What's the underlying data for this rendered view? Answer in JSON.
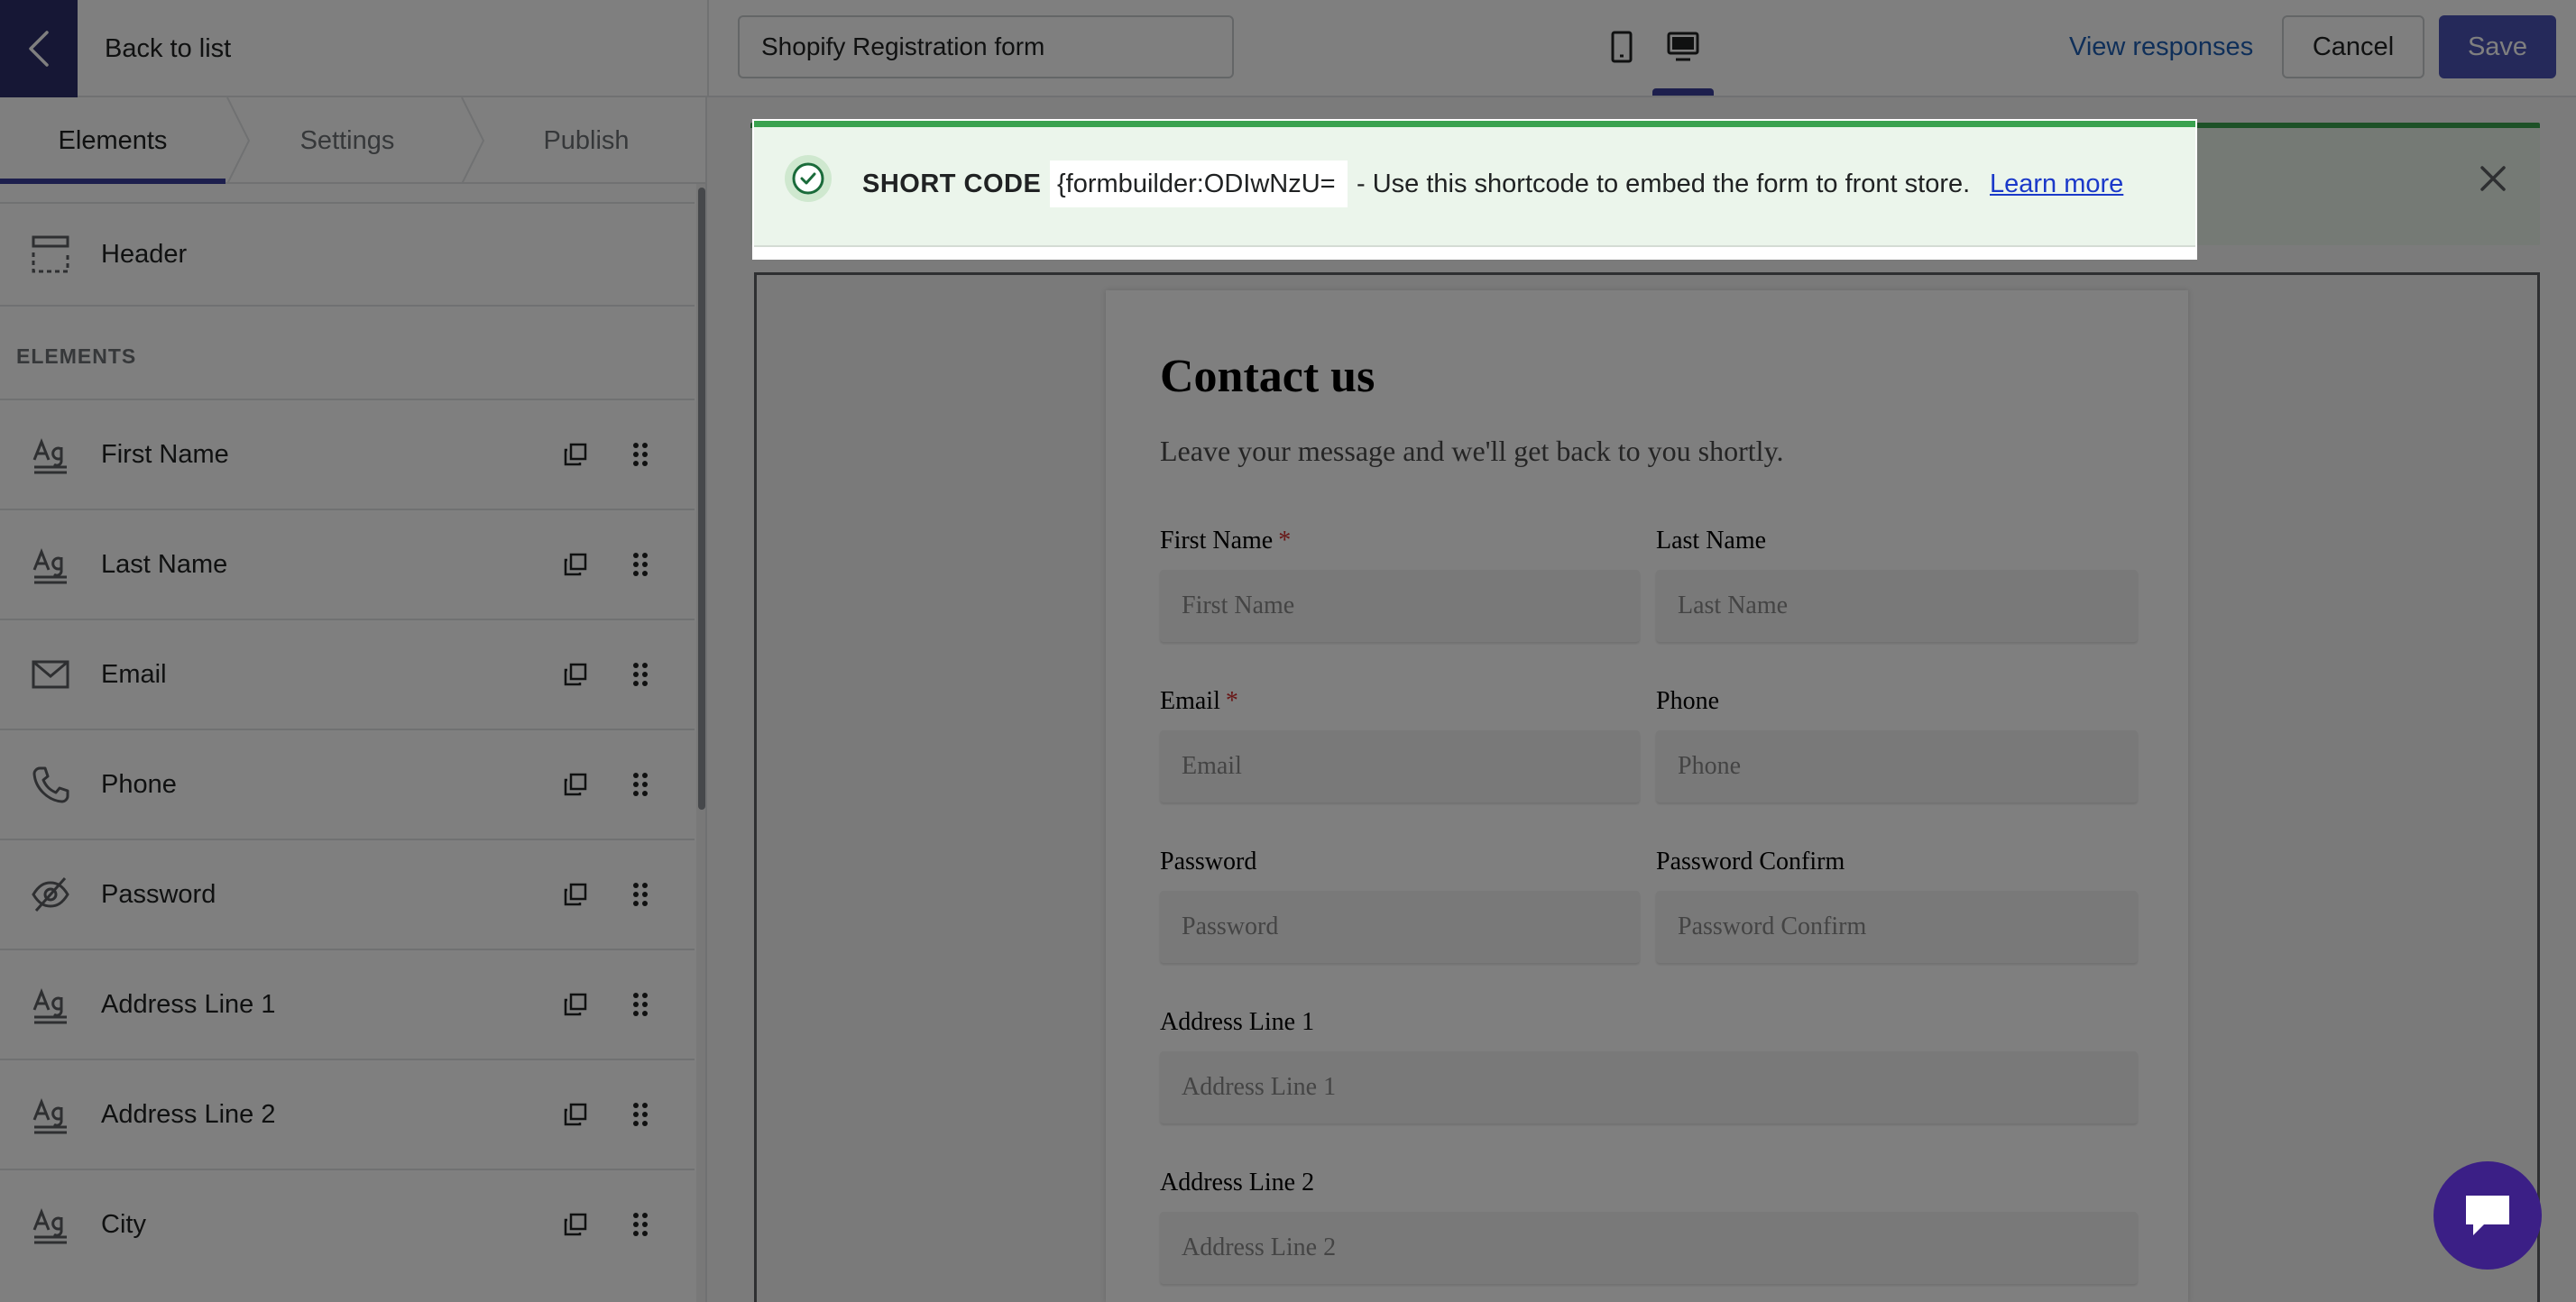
{
  "topbar": {
    "back_label": "Back to list",
    "form_title": "Shopify Registration form",
    "view_responses": "View responses",
    "cancel": "Cancel",
    "save": "Save"
  },
  "sidebar": {
    "tabs": [
      "Elements",
      "Settings",
      "Publish"
    ],
    "header_item": "Header",
    "section_title": "ELEMENTS",
    "items": [
      {
        "label": "First Name",
        "icon": "text-icon"
      },
      {
        "label": "Last Name",
        "icon": "text-icon"
      },
      {
        "label": "Email",
        "icon": "mail-icon"
      },
      {
        "label": "Phone",
        "icon": "phone-icon"
      },
      {
        "label": "Password",
        "icon": "eye-off-icon"
      },
      {
        "label": "Address Line 1",
        "icon": "text-icon"
      },
      {
        "label": "Address Line 2",
        "icon": "text-icon"
      },
      {
        "label": "City",
        "icon": "text-icon"
      }
    ]
  },
  "banner": {
    "label": "SHORT CODE :",
    "code": "{formbuilder:ODIwNzU=",
    "description": "- Use this shortcode to embed the form to front store.",
    "link": "Learn more"
  },
  "form": {
    "heading": "Contact us",
    "description": "Leave your message and we'll get back to you shortly.",
    "fields": {
      "first_name": {
        "label": "First Name",
        "placeholder": "First Name",
        "required": "*"
      },
      "last_name": {
        "label": "Last Name",
        "placeholder": "Last Name"
      },
      "email": {
        "label": "Email",
        "placeholder": "Email",
        "required": "*"
      },
      "phone": {
        "label": "Phone",
        "placeholder": "Phone"
      },
      "password": {
        "label": "Password",
        "placeholder": "Password"
      },
      "password_confirm": {
        "label": "Password Confirm",
        "placeholder": "Password Confirm"
      },
      "address1": {
        "label": "Address Line 1",
        "placeholder": "Address Line 1"
      },
      "address2": {
        "label": "Address Line 2",
        "placeholder": "Address Line 2"
      }
    }
  },
  "colors": {
    "accent": "#3a3f9a",
    "success": "#3aa24f",
    "link": "#1b39c9",
    "chat": "#3b1f86"
  }
}
